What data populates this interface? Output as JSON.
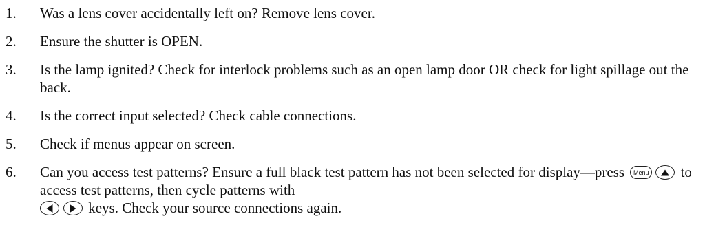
{
  "list": {
    "items": [
      {
        "num": "1.",
        "text": "Was a lens cover accidentally left on? Remove lens cover."
      },
      {
        "num": "2.",
        "text": "Ensure the shutter is OPEN."
      },
      {
        "num": "3.",
        "text": "Is the lamp ignited? Check for interlock problems such as an open lamp door OR check for light spillage out the back."
      },
      {
        "num": "4.",
        "text": "Is the correct input selected? Check cable connections."
      },
      {
        "num": "5.",
        "text": "Check if menus appear on screen."
      },
      {
        "num": "6.",
        "text_a": "Can you access test patterns? Ensure a full black test pattern has not been selected for display—press",
        "menu_key_label": "Menu",
        "text_b": "to access test patterns, then cycle patterns with",
        "text_c": "keys. Check your source connections again."
      }
    ]
  },
  "icons": {
    "menu_key": "menu-key-icon",
    "up_key": "up-arrow-key-icon",
    "left_key": "left-arrow-key-icon",
    "right_key": "right-arrow-key-icon"
  }
}
